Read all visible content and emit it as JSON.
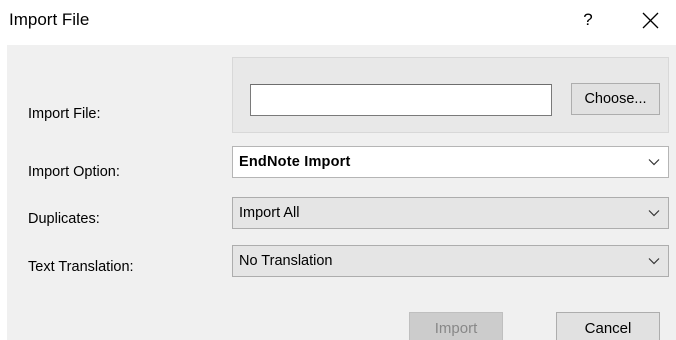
{
  "window": {
    "title": "Import File",
    "help_glyph": "?",
    "close_icon": "close-icon"
  },
  "form": {
    "import_file_label": "Import File:",
    "import_file_value": "",
    "choose_label": "Choose...",
    "import_option_label": "Import Option:",
    "import_option_value": "EndNote Import",
    "duplicates_label": "Duplicates:",
    "duplicates_value": "Import All",
    "text_translation_label": "Text Translation:",
    "text_translation_value": "No Translation"
  },
  "buttons": {
    "import_label": "Import",
    "import_enabled": false,
    "cancel_label": "Cancel"
  }
}
